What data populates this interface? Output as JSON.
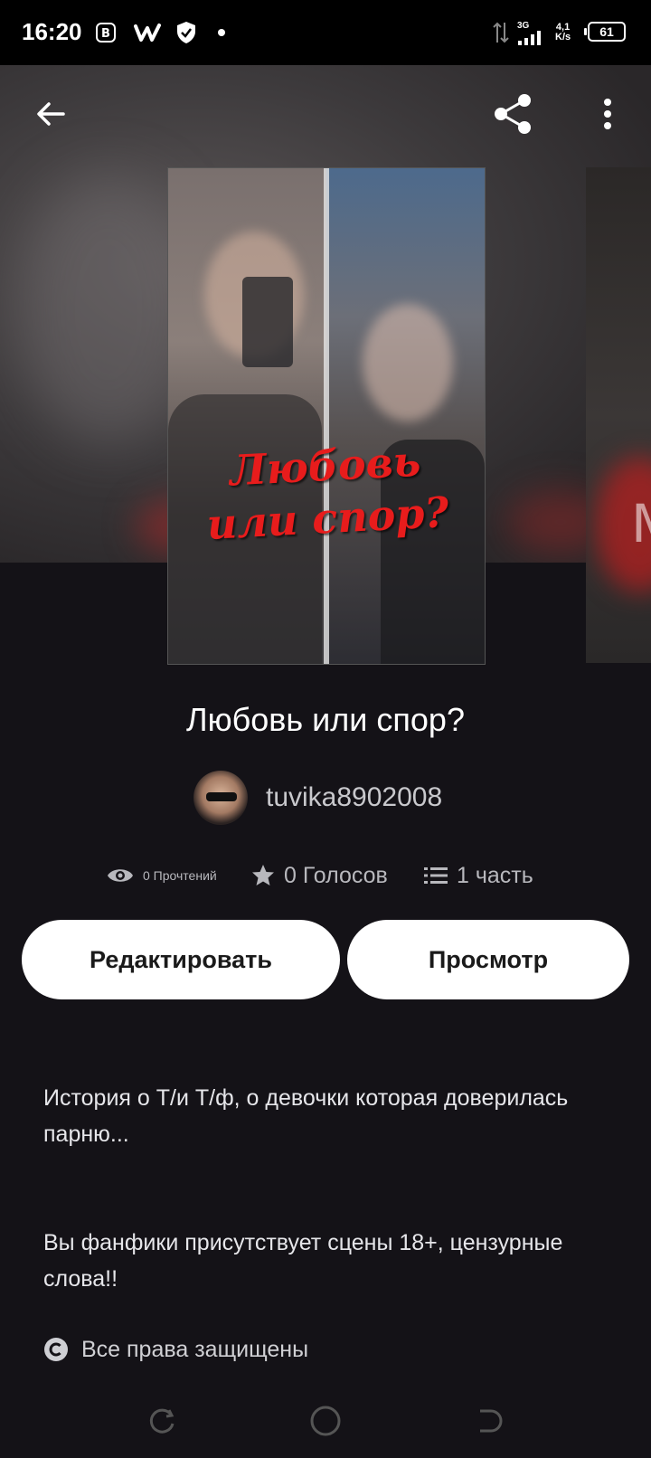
{
  "status_bar": {
    "time": "16:20",
    "network_type": "3G",
    "speed_value": "4,1",
    "speed_unit": "K/s",
    "battery": "61",
    "icons": [
      "b-app-icon",
      "wattpad-icon",
      "shield-icon",
      "dot-icon",
      "data-arrows-icon",
      "signal-icon"
    ]
  },
  "toolbar": {
    "back_icon": "arrow-left-icon",
    "share_icon": "share-icon",
    "more_icon": "more-vertical-icon"
  },
  "cover": {
    "title_line1": "Любовь",
    "title_line2": "или спор?",
    "peek_letter": "M"
  },
  "story": {
    "title": "Любовь или спор?",
    "author": "tuvika8902008"
  },
  "stats": {
    "reads": "0 Прочтений",
    "votes": "0 Голосов",
    "parts": "1 часть"
  },
  "actions": {
    "edit_label": "Редактировать",
    "preview_label": "Просмотр"
  },
  "description": {
    "paragraph1": "История о Т/и Т/ф, о девочки которая доверилась парню...",
    "paragraph2": "Вы фанфики присутствует сцены 18+, цензурные слова!!"
  },
  "copyright": {
    "label": "Все права защищены"
  },
  "colors": {
    "background": "#141217",
    "button_bg": "#ffffff",
    "cover_title": "#e81c1c",
    "muted_text": "#b8b8bd"
  }
}
